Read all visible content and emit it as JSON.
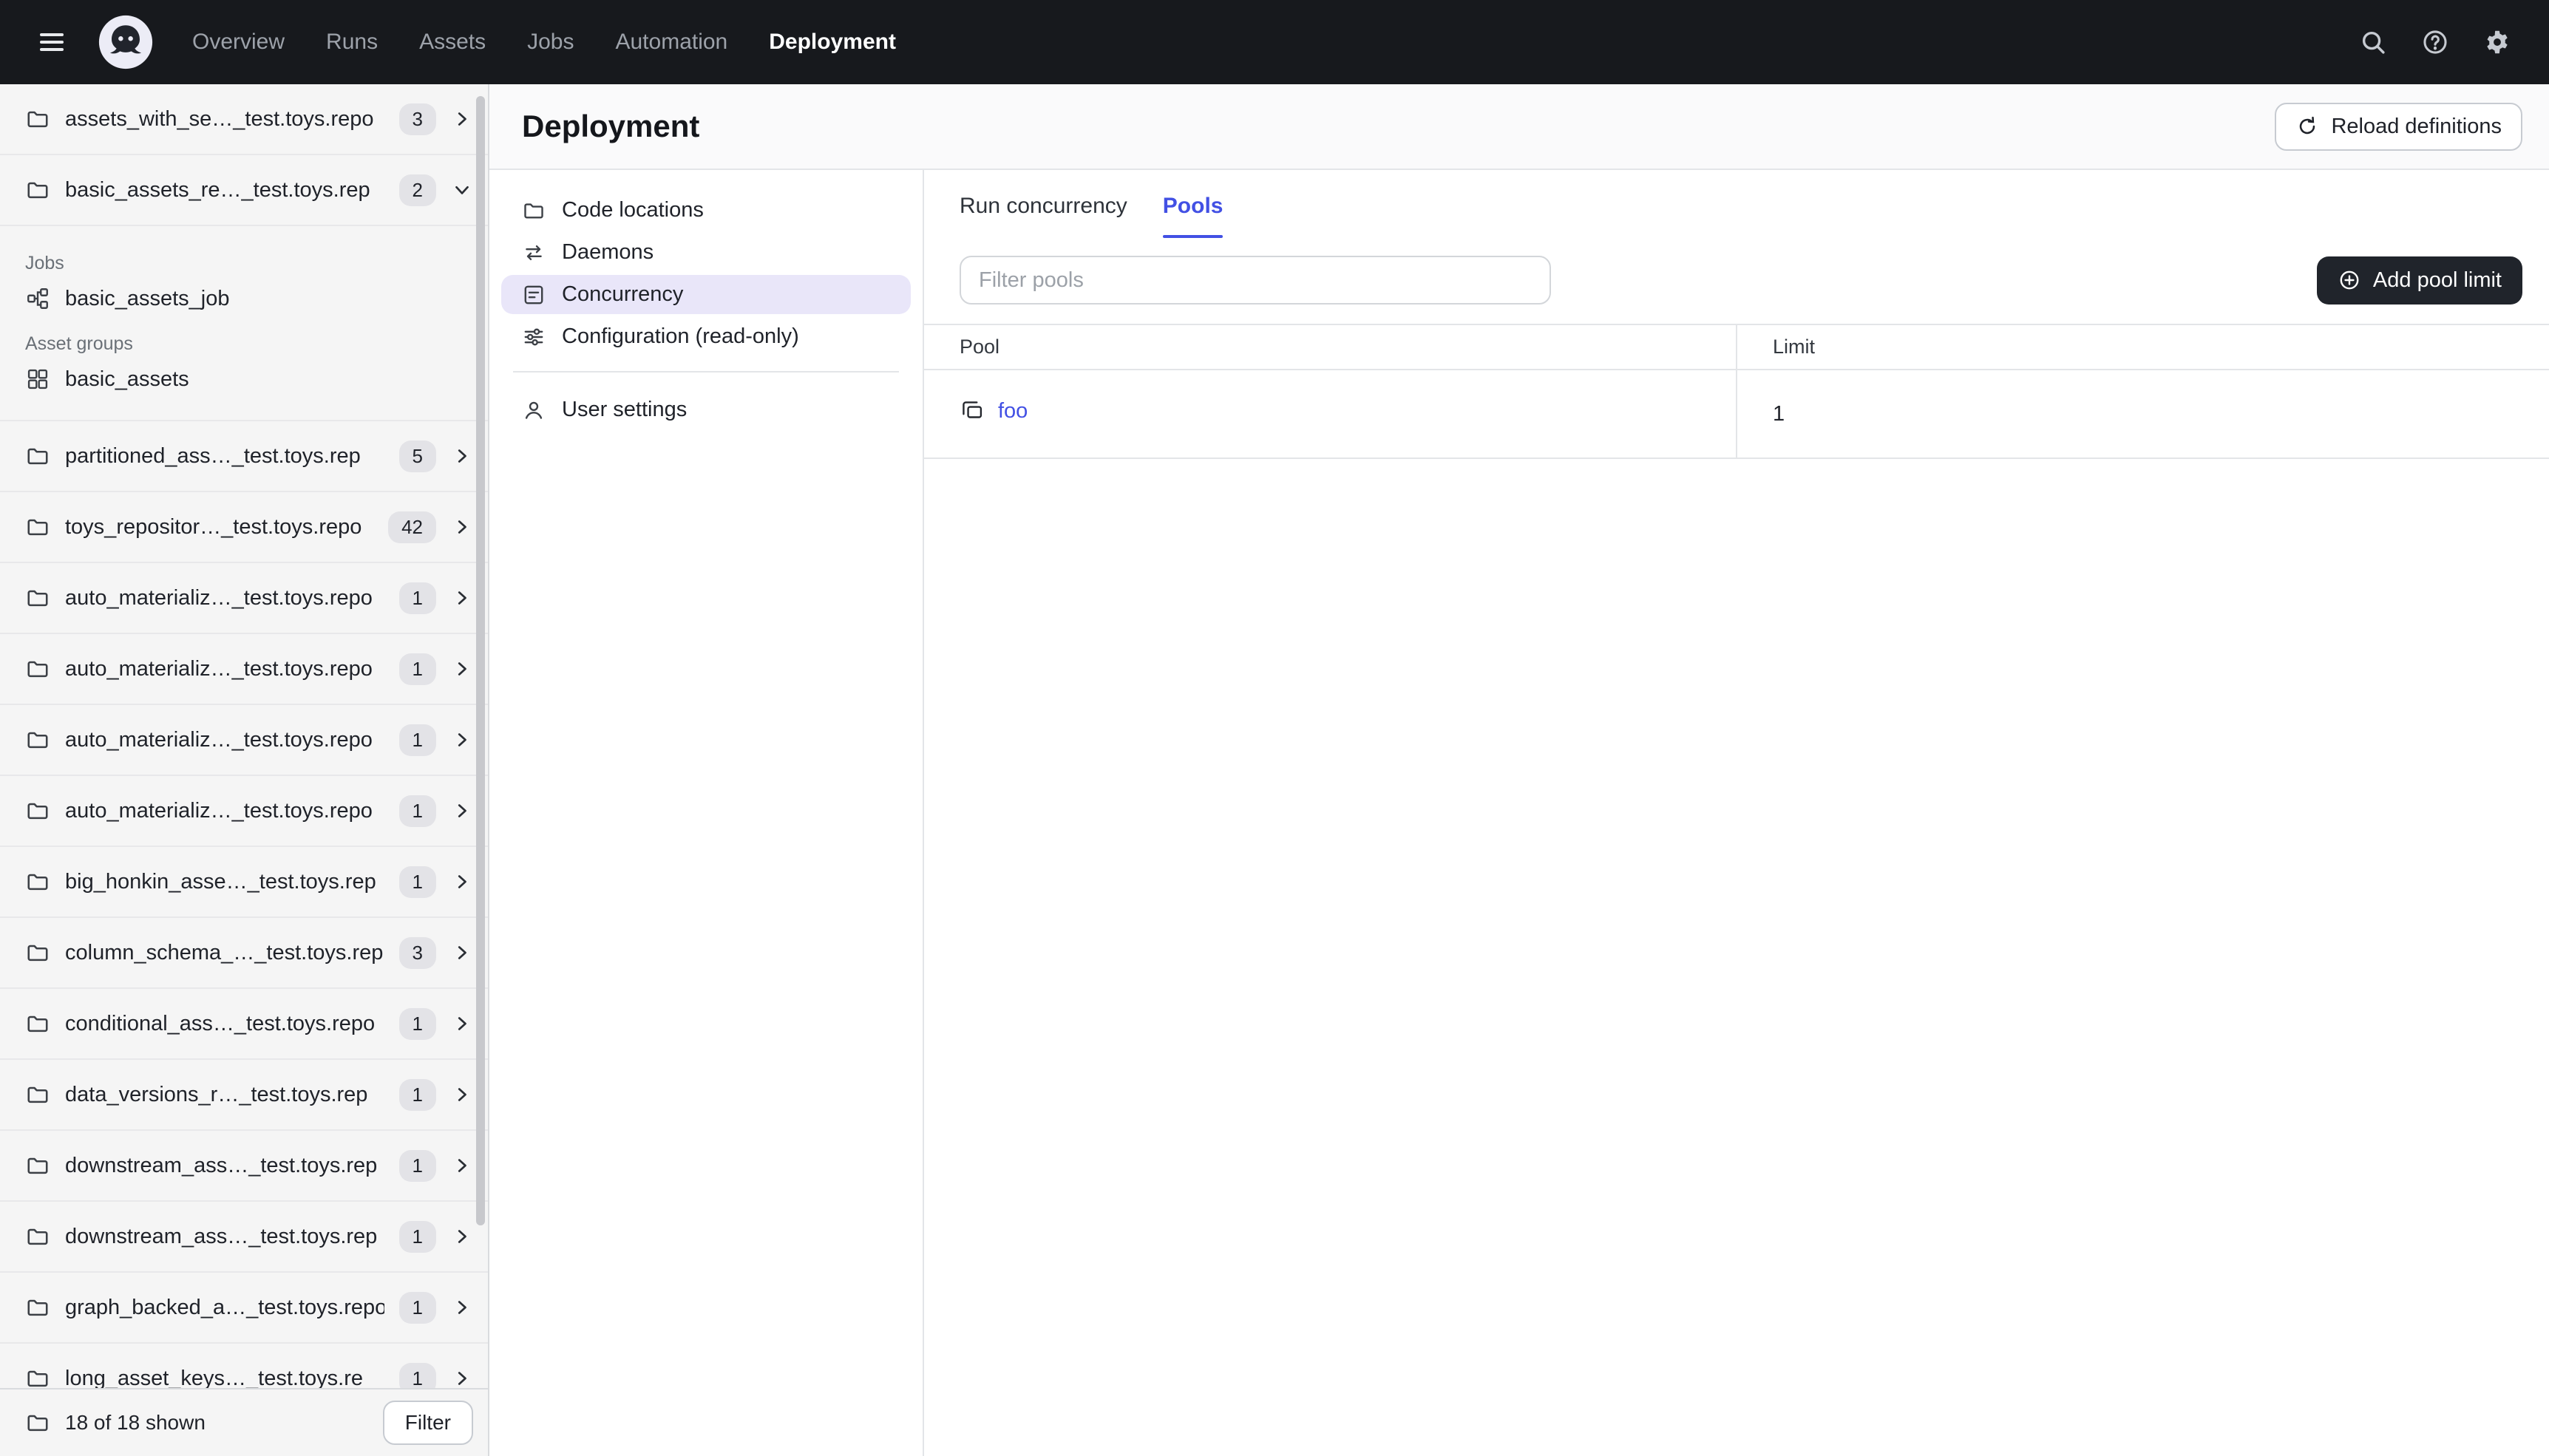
{
  "colors": {
    "accent": "#4250E4",
    "nav_bg": "#17191D",
    "selected_bg": "#E9E6F9"
  },
  "topnav": {
    "nav_items": [
      {
        "label": "Overview",
        "active": false
      },
      {
        "label": "Runs",
        "active": false
      },
      {
        "label": "Assets",
        "active": false
      },
      {
        "label": "Jobs",
        "active": false
      },
      {
        "label": "Automation",
        "active": false
      },
      {
        "label": "Deployment",
        "active": true
      }
    ]
  },
  "sidebar": {
    "items": [
      {
        "name": "assets_with_se…_test.toys.repo",
        "count": "3",
        "expanded": false
      },
      {
        "name": "basic_assets_re…_test.toys.rep",
        "count": "2",
        "expanded": true,
        "sections": [
          {
            "label": "Jobs",
            "entries": [
              {
                "name": "basic_assets_job",
                "icon": "job-icon"
              }
            ]
          },
          {
            "label": "Asset groups",
            "entries": [
              {
                "name": "basic_assets",
                "icon": "asset-group-icon"
              }
            ]
          }
        ]
      },
      {
        "name": "partitioned_ass…_test.toys.rep",
        "count": "5",
        "expanded": false
      },
      {
        "name": "toys_repositor…_test.toys.repo",
        "count": "42",
        "expanded": false
      },
      {
        "name": "auto_materializ…_test.toys.repo",
        "count": "1",
        "expanded": false
      },
      {
        "name": "auto_materializ…_test.toys.repo",
        "count": "1",
        "expanded": false
      },
      {
        "name": "auto_materializ…_test.toys.repo",
        "count": "1",
        "expanded": false
      },
      {
        "name": "auto_materializ…_test.toys.repo",
        "count": "1",
        "expanded": false
      },
      {
        "name": "big_honkin_asse…_test.toys.rep",
        "count": "1",
        "expanded": false
      },
      {
        "name": "column_schema_…_test.toys.rep",
        "count": "3",
        "expanded": false
      },
      {
        "name": "conditional_ass…_test.toys.repo",
        "count": "1",
        "expanded": false
      },
      {
        "name": "data_versions_r…_test.toys.rep",
        "count": "1",
        "expanded": false
      },
      {
        "name": "downstream_ass…_test.toys.rep",
        "count": "1",
        "expanded": false
      },
      {
        "name": "downstream_ass…_test.toys.rep",
        "count": "1",
        "expanded": false
      },
      {
        "name": "graph_backed_a…_test.toys.repo",
        "count": "1",
        "expanded": false
      },
      {
        "name": "long_asset_keys…_test.toys.re",
        "count": "1",
        "expanded": false
      }
    ],
    "footer": {
      "count_text": "18 of 18 shown",
      "filter_button": "Filter"
    }
  },
  "main": {
    "page_title": "Deployment",
    "reload_button": "Reload definitions",
    "subnav": [
      {
        "label": "Code locations",
        "icon": "folder-icon",
        "active": false
      },
      {
        "label": "Daemons",
        "icon": "daemons-icon",
        "active": false
      },
      {
        "label": "Concurrency",
        "icon": "concurrency-icon",
        "active": true
      },
      {
        "label": "Configuration (read-only)",
        "icon": "configuration-icon",
        "active": false
      }
    ],
    "subnav_secondary": [
      {
        "label": "User settings",
        "icon": "user-icon",
        "active": false
      }
    ],
    "tabs": [
      {
        "label": "Run concurrency",
        "active": false
      },
      {
        "label": "Pools",
        "active": true
      }
    ],
    "pools": {
      "filter_placeholder": "Filter pools",
      "add_button": "Add pool limit",
      "table": {
        "columns": [
          "Pool",
          "Limit"
        ],
        "rows": [
          {
            "pool": "foo",
            "limit": "1"
          }
        ]
      }
    }
  }
}
